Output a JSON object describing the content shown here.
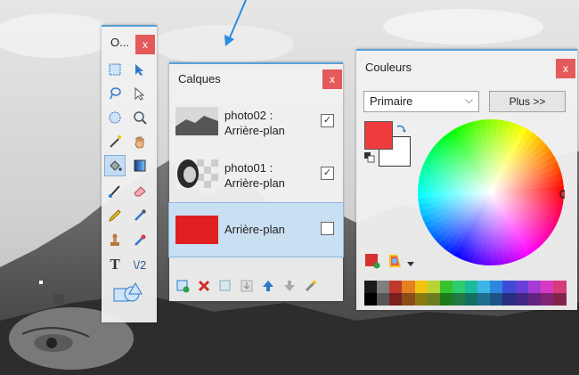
{
  "tools_panel": {
    "title": "O...",
    "close_label": "x",
    "text_tool_glyph": "T",
    "line_tool_glyph": "\\/2"
  },
  "layers_panel": {
    "title": "Calques",
    "close_label": "x",
    "layers": [
      {
        "name_line1": "photo02 :",
        "name_line2": "Arrière-plan",
        "visible": true,
        "selected": false
      },
      {
        "name_line1": "photo01 :",
        "name_line2": "Arrière-plan",
        "visible": true,
        "selected": false
      },
      {
        "name": "Arrière-plan",
        "visible": false,
        "selected": true
      }
    ],
    "check_glyph": "✓"
  },
  "colors_panel": {
    "title": "Couleurs",
    "close_label": "x",
    "mode_select": "Primaire",
    "more_button": "Plus >>",
    "primary_color": "#ef3b3b",
    "secondary_color": "#ffffff",
    "palette_row1": [
      "#1a1a1a",
      "#7f7f7f",
      "#c0392b",
      "#e67e22",
      "#f1c40f",
      "#b7d334",
      "#35c42e",
      "#2ecc71",
      "#1abc9c",
      "#3ab7e5",
      "#2e86de",
      "#3f4bd6",
      "#6c3fd6",
      "#a43bd6",
      "#d63bc1",
      "#d63b7a"
    ],
    "palette_row2": [
      "#000000",
      "#555555",
      "#7b1f1f",
      "#8a4d16",
      "#8a7a10",
      "#6b7d20",
      "#1f7a1c",
      "#1f7a45",
      "#127062",
      "#1f6f8c",
      "#1d5387",
      "#262e82",
      "#412682",
      "#612482",
      "#822475",
      "#82244a"
    ]
  },
  "colors": {
    "accent": "#5aa0d6",
    "close": "#e45a5a",
    "layer_fill": "#e02020"
  }
}
